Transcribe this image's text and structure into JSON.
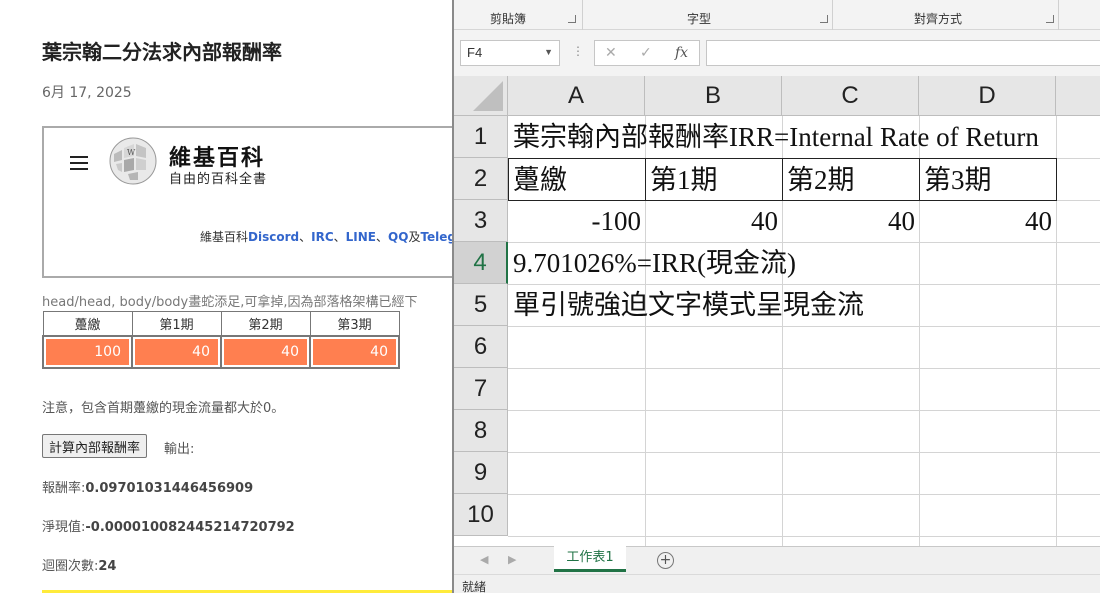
{
  "blog": {
    "title": "葉宗翰二分法求內部報酬率",
    "date": "6月 17, 2025",
    "wiki": {
      "name": "維基百科",
      "tagline": "自由的百科全書",
      "links_prefix": "維基百科",
      "link_discord": "Discord",
      "sep1": "、",
      "link_irc": "IRC",
      "sep2": "、",
      "link_line": "LINE",
      "sep3": "、",
      "link_qq": "QQ",
      "and": "及",
      "link_teleg": "Teleg"
    },
    "note_head": "head/head, body/body畫蛇添足,可拿掉,因為部落格架構已經下",
    "table": {
      "headers": [
        "躉繳",
        "第1期",
        "第2期",
        "第3期"
      ],
      "values": [
        "100",
        "40",
        "40",
        "40"
      ]
    },
    "note_positive": "注意，包含首期躉繳的現金流量都大於0。",
    "calc_button": "計算內部報酬率",
    "output_label": "輸出:",
    "rate_label": "報酬率:",
    "rate_value": "0.09701031446456909",
    "npv_label": "淨現值:",
    "npv_value": "-0.000010082445214720792",
    "loop_label": "迴圈次數:",
    "loop_value": "24"
  },
  "excel": {
    "ribbon_groups": [
      "剪貼簿",
      "字型",
      "對齊方式"
    ],
    "name_box": "F4",
    "fx_cancel": "✕",
    "fx_enter": "✓",
    "fx_label": "fx",
    "columns": [
      "A",
      "B",
      "C",
      "D"
    ],
    "rows": [
      "1",
      "2",
      "3",
      "4",
      "5",
      "6",
      "7",
      "8",
      "9",
      "10"
    ],
    "cells": {
      "a1": "葉宗翰內部報酬率IRR=Internal Rate of Return",
      "a2": "躉繳",
      "b2": "第1期",
      "c2": "第2期",
      "d2": "第3期",
      "a3": "-100",
      "b3": "40",
      "c3": "40",
      "d3": "40",
      "a4": "9.701026%=IRR(現金流)",
      "a5": "單引號強迫文字模式呈現金流"
    },
    "sheet_tab": "工作表1",
    "status": "就緒"
  },
  "colors": {
    "accent_orange": "#ff7f50",
    "excel_green": "#217346",
    "link_blue": "#3366cc"
  }
}
